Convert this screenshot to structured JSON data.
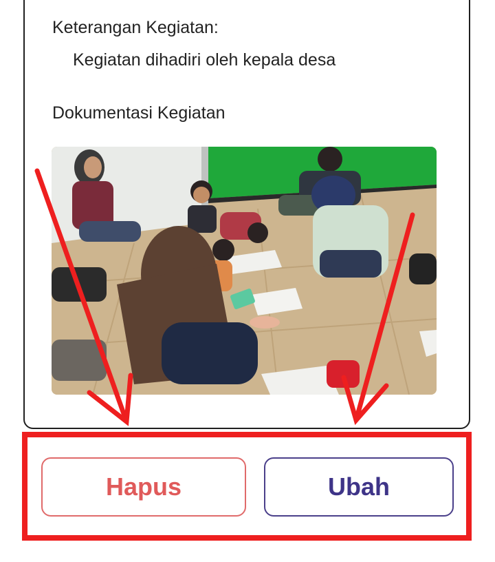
{
  "detail": {
    "keterangan_label": "Keterangan Kegiatan:",
    "keterangan_value": "Kegiatan dihadiri oleh kepala desa",
    "dokumentasi_label": "Dokumentasi Kegiatan"
  },
  "photo": {
    "description_icon": "activity-photo"
  },
  "actions": {
    "hapus_label": "Hapus",
    "ubah_label": "Ubah"
  },
  "colors": {
    "hapus": "#e05a5a",
    "ubah": "#3e3488",
    "annotation": "#ee1f1f"
  }
}
